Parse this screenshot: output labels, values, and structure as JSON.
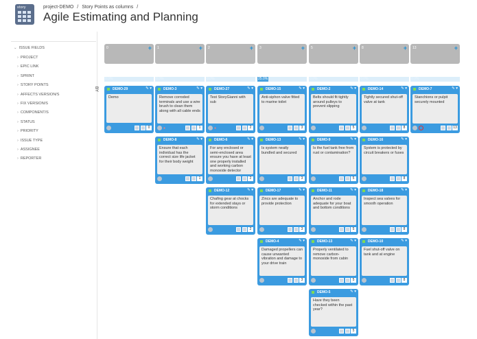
{
  "header": {
    "project": "project-DEMO",
    "sep": "/",
    "view": "Story Points as columns",
    "title": "Agile Estimating and Planning",
    "logo_text": "story"
  },
  "sidebar": {
    "head": "ISSUE FIELDS",
    "items": [
      "PROJECT",
      "EPIC LINK",
      "SPRINT",
      "STORY POINTS",
      "AFFECTS VERSION/S",
      "FIX VERSION/S",
      "COMPONENT/S",
      "STATUS",
      "PRIORITY",
      "ISSUE TYPE",
      "ASSIGNEE",
      "REPORTER"
    ]
  },
  "board": {
    "by_label": "BY",
    "columns": [
      {
        "value": "0",
        "pct": "0.0%",
        "active": false
      },
      {
        "value": "1",
        "pct": "0.0%",
        "active": false
      },
      {
        "value": "2",
        "pct": "0.0%",
        "active": false
      },
      {
        "value": "3",
        "pct": "25.0%",
        "active": true
      },
      {
        "value": "5",
        "pct": "0.0%",
        "active": false
      },
      {
        "value": "8",
        "pct": "0.0%",
        "active": false
      },
      {
        "value": "13",
        "pct": "0.0%",
        "active": false
      }
    ],
    "cards": [
      [
        {
          "key": "DEMO-29",
          "text": "Demo",
          "points": "0"
        }
      ],
      [
        {
          "key": "DEMO-3",
          "text": "Remove corroded terminals and use a wire brush to clean them along with all cable ends",
          "points": "1"
        },
        {
          "key": "DEMO-8",
          "text": "Ensure that each individual has the correct size life jacket for their body weight",
          "points": "1"
        }
      ],
      [
        {
          "key": "DEMO-27",
          "text": "Test StoryGianni with sub",
          "points": "2"
        },
        {
          "key": "DEMO-6",
          "text": "For any enclosed or semi-enclosed area ensure you have at least one properly installed and working carbon monoxide detector",
          "points": "2"
        },
        {
          "key": "DEMO-12",
          "text": "Chafing gear at chocks for extended stays or storm conditions",
          "points": "2"
        }
      ],
      [
        {
          "key": "DEMO-15",
          "text": "Anti-siphon valve fitted to marine toilet",
          "points": "3"
        },
        {
          "key": "DEMO-13",
          "text": "Is system neatly bundled and secured",
          "points": "3"
        },
        {
          "key": "DEMO-17",
          "text": "Zincs are adequate to provide protection",
          "points": "3"
        },
        {
          "key": "DEMO-4",
          "text": "Damaged propellers can cause unwanted vibration and damage to your drive train",
          "points": "3"
        }
      ],
      [
        {
          "key": "DEMO-2",
          "text": "Belts should fit tightly around pulleys to prevent slipping",
          "points": "5"
        },
        {
          "key": "DEMO-9",
          "text": "Is the fuel tank free from rust or contamination?",
          "points": "5"
        },
        {
          "key": "DEMO-11",
          "text": "Anchor and rode adequate for your boat and bottom conditions",
          "points": "5"
        },
        {
          "key": "DEMO-13",
          "text": "Properly ventilated to remove carbon-monoxide from cabin",
          "points": "5"
        },
        {
          "key": "DEMO-5",
          "text": "Have they been checked within the past year?",
          "points": "5"
        }
      ],
      [
        {
          "key": "DEMO-14",
          "text": "Tightly secured shut-off valve at tank",
          "points": "8"
        },
        {
          "key": "DEMO-16",
          "text": "System is protected by circuit breakers or fuses",
          "points": "8"
        },
        {
          "key": "DEMO-18",
          "text": "Inspect sea valves for smooth operation",
          "points": "8"
        },
        {
          "key": "DEMO-10",
          "text": "Fuel shut-off valve on tank and at engine",
          "points": "8"
        }
      ],
      [
        {
          "key": "DEMO-7",
          "text": "Stanchions or pulpit securely mounted",
          "points": "13"
        }
      ]
    ]
  },
  "colors": {
    "card": "#3b9be0",
    "column_head": "#b8b8b8",
    "accent": "#1a8fd9"
  },
  "icons": {
    "add": "plus-icon",
    "edit": "pencil-icon",
    "menu": "dropdown-icon",
    "avatar": "user-avatar-icon"
  }
}
